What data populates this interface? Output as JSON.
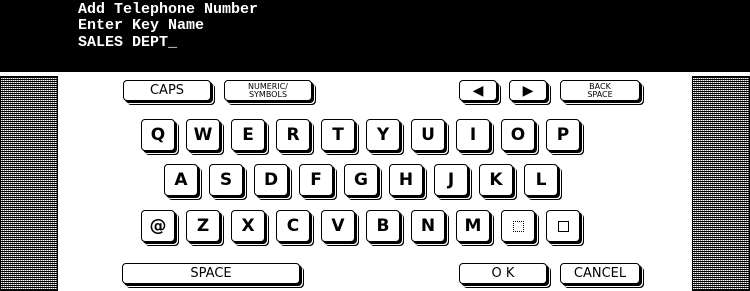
{
  "header": {
    "line1": "Add Telephone Number",
    "line2": "Enter Key Name",
    "line3": "SALES DEPT_"
  },
  "function_keys": {
    "caps": "CAPS",
    "numeric_line1": "NUMERIC/",
    "numeric_line2": "SYMBOLS",
    "left_arrow": "◀",
    "right_arrow": "▶",
    "back_line1": "BACK",
    "back_line2": "SPACE"
  },
  "rows": {
    "row1": [
      "Q",
      "W",
      "E",
      "R",
      "T",
      "Y",
      "U",
      "I",
      "O",
      "P"
    ],
    "row2": [
      "A",
      "S",
      "D",
      "F",
      "G",
      "H",
      "J",
      "K",
      "L"
    ],
    "row3": [
      "@",
      "Z",
      "X",
      "C",
      "V",
      "B",
      "N",
      "M"
    ]
  },
  "bottom": {
    "space": "SPACE",
    "ok": "O K",
    "cancel": "CANCEL"
  }
}
